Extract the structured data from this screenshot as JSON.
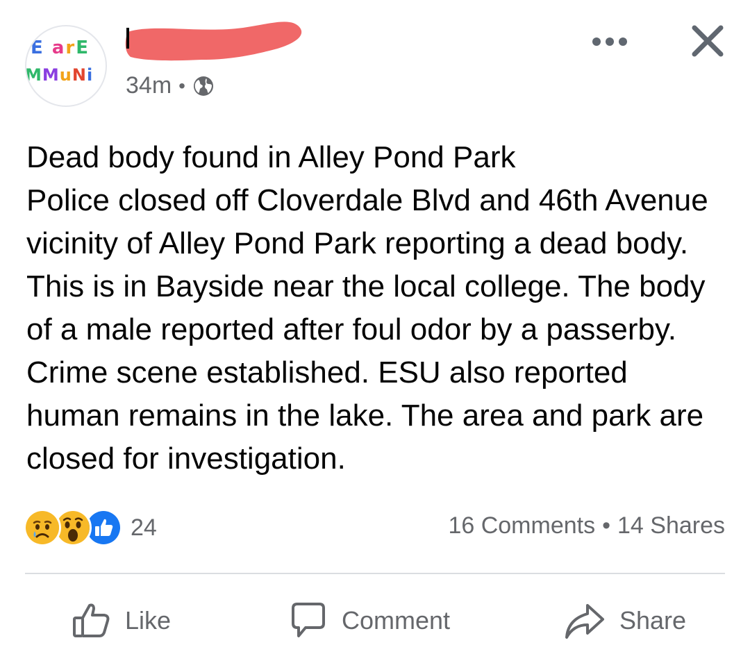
{
  "header": {
    "avatar_line1": "E arE",
    "avatar_line2": "MMuNi",
    "timestamp": "34m",
    "separator": "•",
    "redaction_color": "#f06868"
  },
  "post": {
    "lines": [
      "Dead body found in Alley Pond Park",
      "Police closed off Cloverdale Blvd and 46th Avenue vicinity of Alley Pond Park reporting a dead body. This is in Bayside near the local college. The body of a male reported after foul odor by a passerby. Crime scene established. ESU also reported human remains in the lake. The area and park are closed for investigation."
    ]
  },
  "reactions": {
    "icons": [
      "sad-reaction-icon",
      "wow-reaction-icon",
      "like-reaction-icon"
    ],
    "count": "24",
    "comments": "16 Comments",
    "separator": "•",
    "shares": "14 Shares"
  },
  "actions": {
    "like_label": "Like",
    "comment_label": "Comment",
    "share_label": "Share"
  },
  "colors": {
    "secondary_text": "#65676b",
    "like_blue": "#1877f2",
    "reaction_yellow": "#f7b928",
    "divider": "#dadde1"
  }
}
